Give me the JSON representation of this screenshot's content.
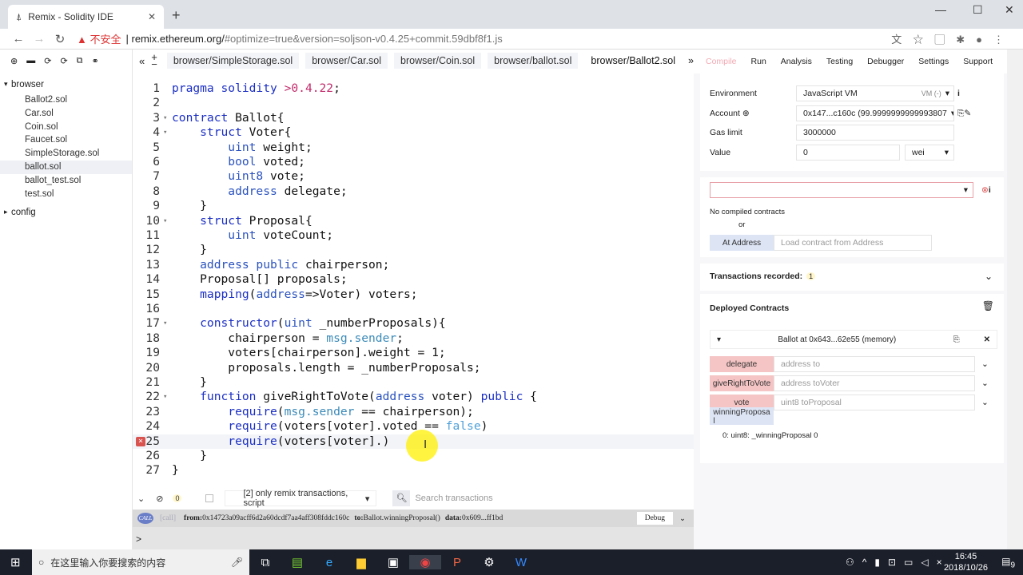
{
  "browser": {
    "tab_title": "Remix - Solidity IDE",
    "security": "不安全",
    "url_host": "remix.ethereum.org/",
    "url_rest": "#optimize=true&version=soljson-v0.4.25+commit.59dbf8f1.js"
  },
  "files": {
    "root": "browser",
    "items": [
      "Ballot2.sol",
      "Car.sol",
      "Coin.sol",
      "Faucet.sol",
      "SimpleStorage.sol",
      "ballot.sol",
      "ballot_test.sol",
      "test.sol"
    ],
    "selected": 5,
    "config": "config"
  },
  "editor_tabs": [
    "browser/SimpleStorage.sol",
    "browser/Car.sol",
    "browser/Coin.sol",
    "browser/ballot.sol",
    "browser/Ballot2.sol"
  ],
  "active_tab": 4,
  "code": [
    [
      [
        "pragma solidity ",
        "k"
      ],
      [
        ">0.4.22",
        "l"
      ],
      [
        ";",
        "p"
      ]
    ],
    [],
    [
      [
        "contract ",
        "k"
      ],
      [
        "Ballot{",
        "p"
      ]
    ],
    [
      [
        "    struct ",
        "k"
      ],
      [
        "Voter{",
        "p"
      ]
    ],
    [
      [
        "        uint ",
        "t"
      ],
      [
        "weight;",
        "p"
      ]
    ],
    [
      [
        "        bool ",
        "t"
      ],
      [
        "voted;",
        "p"
      ]
    ],
    [
      [
        "        uint8 ",
        "t"
      ],
      [
        "vote;",
        "p"
      ]
    ],
    [
      [
        "        address ",
        "t"
      ],
      [
        "delegate;",
        "p"
      ]
    ],
    [
      [
        "    }",
        "p"
      ]
    ],
    [
      [
        "    struct ",
        "k"
      ],
      [
        "Proposal{",
        "p"
      ]
    ],
    [
      [
        "        uint ",
        "t"
      ],
      [
        "voteCount;",
        "p"
      ]
    ],
    [
      [
        "    }",
        "p"
      ]
    ],
    [
      [
        "    address public ",
        "t"
      ],
      [
        "chairperson;",
        "p"
      ]
    ],
    [
      [
        "    Proposal[] proposals;",
        "p"
      ]
    ],
    [
      [
        "    mapping",
        "k"
      ],
      [
        "(",
        "p"
      ],
      [
        "address",
        "t"
      ],
      [
        "=>Voter) voters;",
        "p"
      ]
    ],
    [],
    [
      [
        "    constructor",
        "k"
      ],
      [
        "(",
        "p"
      ],
      [
        "uint ",
        "t"
      ],
      [
        "_numberProposals){",
        "p"
      ]
    ],
    [
      [
        "        chairperson = ",
        "p"
      ],
      [
        "msg.sender",
        "g"
      ],
      [
        ";",
        "p"
      ]
    ],
    [
      [
        "        voters[chairperson].weight = 1;",
        "p"
      ]
    ],
    [
      [
        "        proposals.length = _numberProposals;",
        "p"
      ]
    ],
    [
      [
        "    }",
        "p"
      ]
    ],
    [
      [
        "    function ",
        "k"
      ],
      [
        "giveRightToVote(",
        "p"
      ],
      [
        "address ",
        "t"
      ],
      [
        "voter) ",
        "p"
      ],
      [
        "public ",
        "k"
      ],
      [
        "{",
        "p"
      ]
    ],
    [
      [
        "        require",
        "k"
      ],
      [
        "(",
        "p"
      ],
      [
        "msg.sender",
        "g"
      ],
      [
        " == chairperson);",
        "p"
      ]
    ],
    [
      [
        "        require",
        "k"
      ],
      [
        "(voters[voter].voted == ",
        "p"
      ],
      [
        "false",
        "f"
      ],
      [
        ")",
        "p"
      ]
    ],
    [
      [
        "        require",
        "k"
      ],
      [
        "(voters[voter].)",
        "p"
      ]
    ],
    [
      [
        "    }",
        "p"
      ]
    ],
    [
      [
        "}",
        "p"
      ]
    ]
  ],
  "fold_lines": [
    3,
    4,
    10,
    17,
    22
  ],
  "error_line": 25,
  "current_line": 25,
  "terminal": {
    "count": "0",
    "filter": "[2] only remix transactions, script",
    "search_placeholder": "Search transactions",
    "badge": "CALL",
    "log_tag": "[call]",
    "log_from_label": "from:",
    "log_from": "0x14723a09acff6d2a60dcdf7aa4aff308fddc160c",
    "log_to_label": "to:",
    "log_to": "Ballot.winningProposal()",
    "log_data_label": "data:",
    "log_data": "0x609...ff1bd",
    "debug": "Debug",
    "prompt": ">"
  },
  "run_tabs": [
    "Compile",
    "Run",
    "Analysis",
    "Testing",
    "Debugger",
    "Settings",
    "Support"
  ],
  "run": {
    "env_label": "Environment",
    "env_value": "JavaScript VM",
    "env_vm": "VM (-)",
    "account_label": "Account",
    "account_value": "0x147...c160c (99.9999999999993807",
    "gas_label": "Gas limit",
    "gas_value": "3000000",
    "value_label": "Value",
    "value_value": "0",
    "unit": "wei",
    "no_contracts": "No compiled contracts",
    "or": "or",
    "at_address": "At Address",
    "at_address_placeholder": "Load contract from Address",
    "tx_recorded": "Transactions recorded:",
    "tx_count": "1",
    "deployed": "Deployed Contracts",
    "instance": "Ballot at 0x643...62e55 (memory)",
    "functions": [
      {
        "name": "delegate",
        "placeholder": "address to"
      },
      {
        "name": "giveRightToVote",
        "placeholder": "address toVoter"
      },
      {
        "name": "vote",
        "placeholder": "uint8 toProposal"
      }
    ],
    "call_fn": "winningProposa\nl",
    "call_result": "0: uint8: _winningProposal 0"
  },
  "taskbar": {
    "search": "在这里输入你要搜索的内容",
    "time": "16:45",
    "date": "2018/10/26",
    "notif": "9"
  }
}
